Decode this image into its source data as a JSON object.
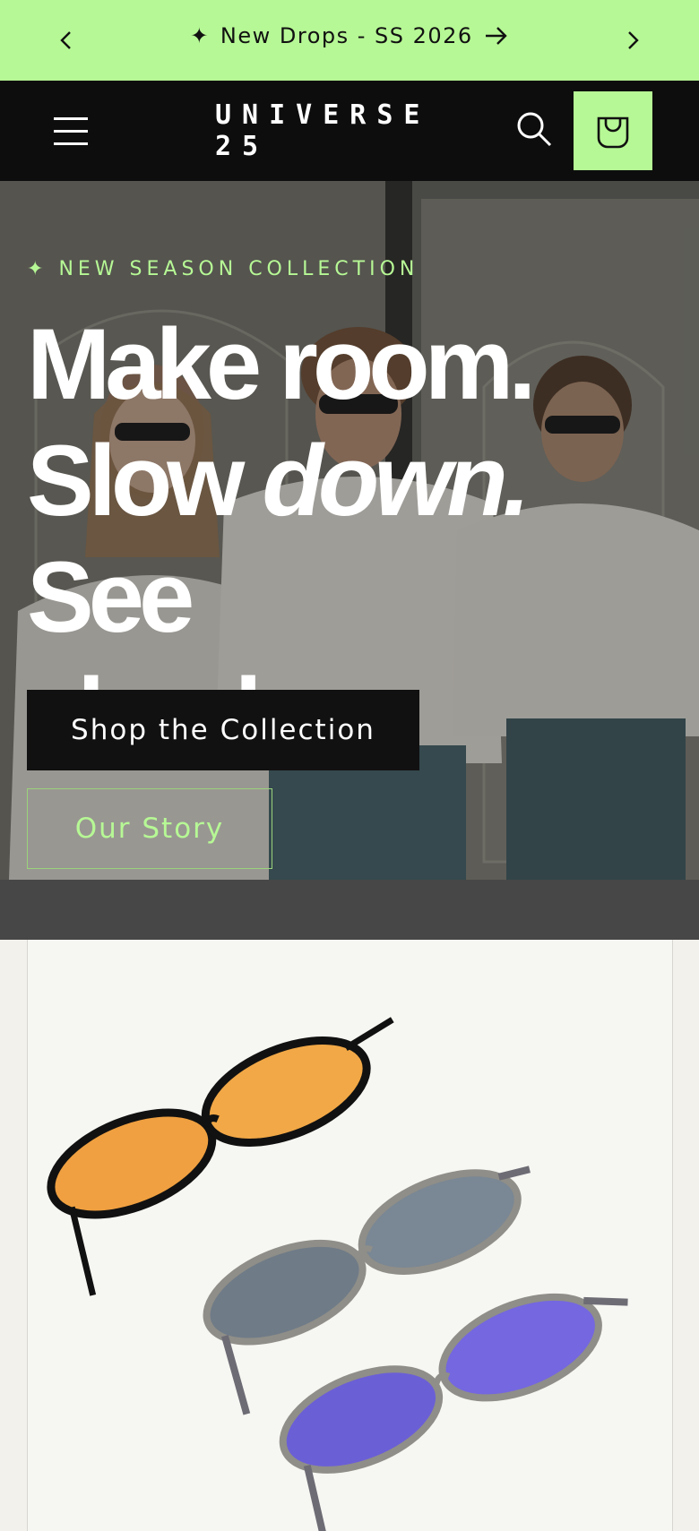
{
  "announcement": {
    "message": "New Drops - SS 2026",
    "background": "#b6f895"
  },
  "header": {
    "brand": "UNIVERSE 25",
    "icons": [
      "menu-icon",
      "search-icon",
      "cart-icon"
    ]
  },
  "hero": {
    "eyebrow": "NEW SEASON COLLECTION",
    "headline_line1": "Make room.",
    "headline_line2a": "Slow ",
    "headline_line2b": "down.",
    "headline_line2c": " See",
    "headline_line3": "clearly.",
    "primary_cta": "Shop the Collection",
    "secondary_cta": "Our Story"
  },
  "colors": {
    "accent": "#b6f895",
    "dark": "#0d0d0d"
  }
}
